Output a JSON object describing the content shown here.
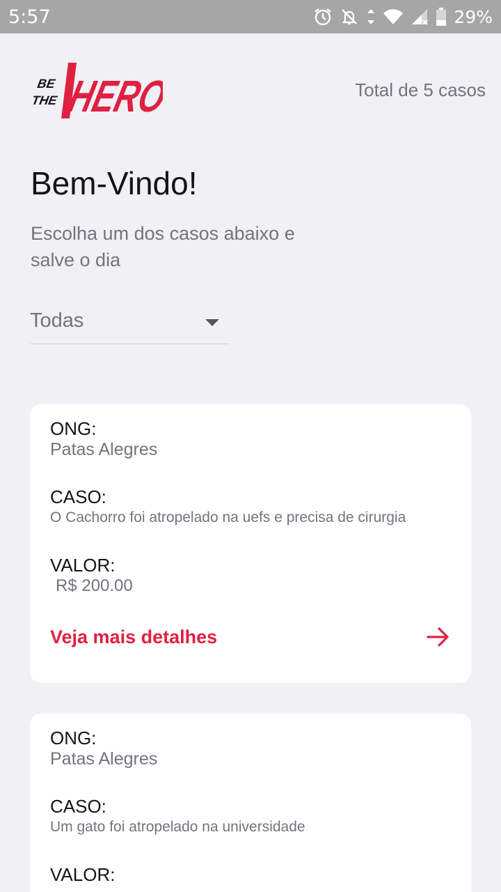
{
  "status_bar": {
    "time": "5:57",
    "battery": "29%",
    "icons": [
      "alarm-icon",
      "notifications-off-icon",
      "data-arrows-icon",
      "wifi-icon",
      "cell-signal-icon",
      "battery-icon"
    ]
  },
  "header": {
    "logo": "BE THE HERO",
    "total": "Total de 5 casos"
  },
  "welcome": {
    "title": "Bem-Vindo!",
    "description": "Escolha um dos casos abaixo e salve o dia"
  },
  "filter": {
    "selected": "Todas"
  },
  "colors": {
    "accent": "#e02041",
    "background": "#f0f0f5",
    "text_dark": "#13131a",
    "text_muted": "#737380"
  },
  "cases": [
    {
      "ong_label": "ONG:",
      "ong": "Patas Alegres",
      "case_label": "CASO:",
      "title": "O Cachorro foi atropelado na uefs e precisa de cirurgia",
      "value_label": "VALOR:",
      "value": "R$ 200.00",
      "details": "Veja mais detalhes"
    },
    {
      "ong_label": "ONG:",
      "ong": "Patas Alegres",
      "case_label": "CASO:",
      "title": "Um gato foi atropelado na universidade",
      "value_label": "VALOR:"
    }
  ]
}
